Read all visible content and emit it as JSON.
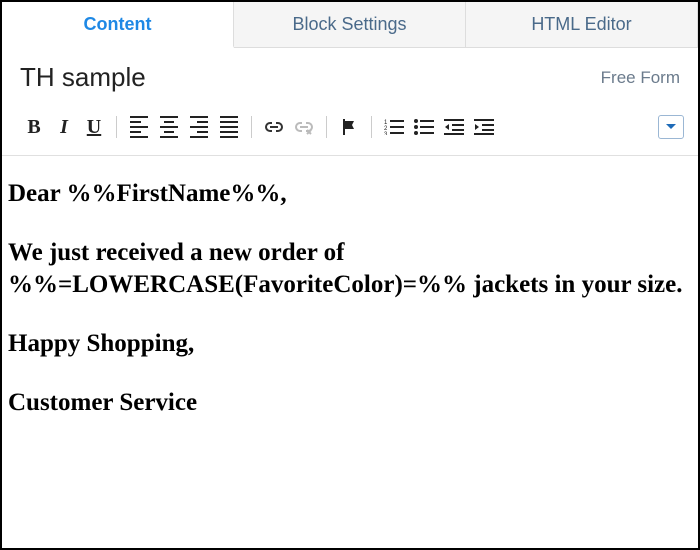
{
  "tabs": {
    "content": "Content",
    "blockSettings": "Block Settings",
    "htmlEditor": "HTML Editor"
  },
  "header": {
    "title": "TH sample",
    "typeLabel": "Free Form"
  },
  "toolbar": {
    "boldGlyph": "B",
    "italicGlyph": "I",
    "underlineGlyph": "U"
  },
  "content": {
    "p1": "Dear %%FirstName%%,",
    "p2": "We just received a new order of %%=LOWERCASE(FavoriteColor)=%% jackets in your size.",
    "p3": "Happy Shopping,",
    "p4": "Customer Service"
  }
}
